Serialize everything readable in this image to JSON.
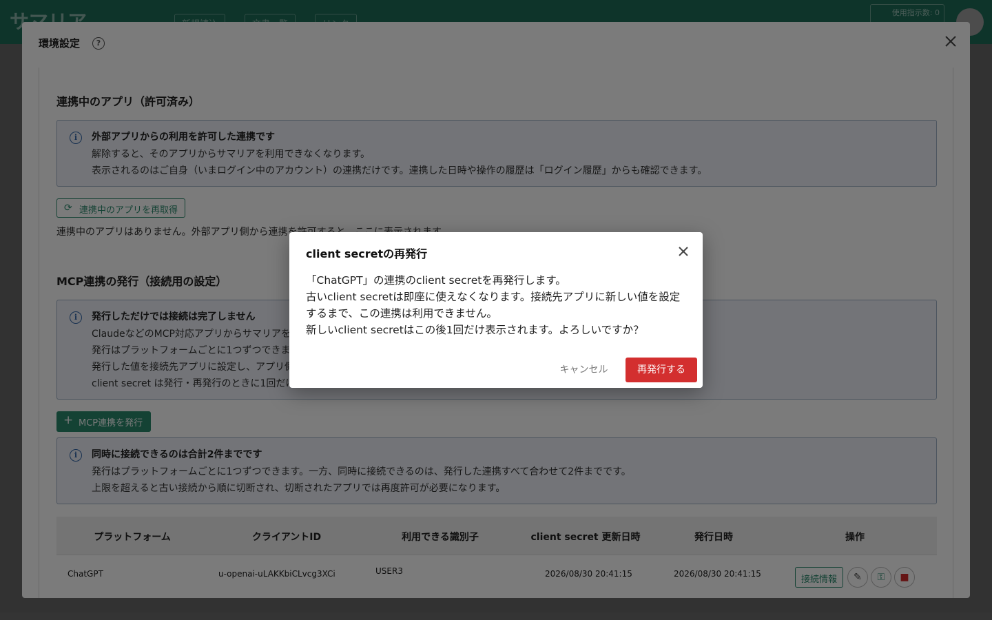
{
  "app": {
    "logo_text": "サマリア",
    "header_buttons": [
      "新規読込",
      "文書一覧",
      "リンク"
    ],
    "counter_label": "使用指示数:",
    "counter_value": "0"
  },
  "settings": {
    "title": "環境設定",
    "connected_apps": {
      "title": "連携中のアプリ（許可済み）",
      "info_head": "外部アプリからの利用を許可した連携です",
      "info_lines": [
        "解除すると、そのアプリからサマリアを利用できなくなります。",
        "表示されるのはご自身（いまログイン中のアカウント）の連携だけです。連携した日時や操作の履歴は「ログイン履歴」からも確認できます。"
      ],
      "refresh_label": "連携中のアプリを再取得",
      "empty_text": "連携中のアプリはありません。外部アプリ側から連携を許可すると、ここに表示されます。"
    },
    "mcp": {
      "title": "MCP連携の発行（接続用の設定）",
      "info_head": "発行しただけでは接続は完了しません",
      "info_lines": [
        "ClaudeなどのMCP対応アプリからサマリアを",
        "発行はプラットフォームごとに1つずつできま",
        "発行した値を接続先アプリに設定し、アプリ側",
        "client secret は発行・再発行のときに1回だけ"
      ],
      "issue_label": "MCP連携を発行",
      "limit_head": "同時に接続できるのは合計2件までです",
      "limit_lines": [
        "発行はプラットフォームごとに1つずつできます。一方、同時に接続できるのは、発行した連携すべて合わせて2件までです。",
        "上限を超えると古い接続から順に切断され、切断されたアプリでは再度許可が必要になります。"
      ]
    },
    "table": {
      "headers": [
        "プラットフォーム",
        "クライアントID",
        "利用できる識別子",
        "client secret 更新日時",
        "発行日時",
        "操作"
      ],
      "rows": [
        {
          "platform": "ChatGPT",
          "client_id": "u-openai-uLAKKbiCLvcg3XCi",
          "identifier": "USER3",
          "secret_updated": "2026/08/30 20:41:15",
          "issued": "2026/08/30 20:41:15",
          "connection_info_label": "接続情報"
        }
      ]
    }
  },
  "confirm": {
    "title": "client secretの再発行",
    "lines": [
      "「ChatGPT」の連携のclient secretを再発行します。",
      "古いclient secretは即座に使えなくなります。接続先アプリに新しい値を設定",
      "するまで、この連携は利用できません。",
      "新しいclient secretはこの後1回だけ表示されます。よろしいですか？"
    ],
    "cancel_label": "キャンセル",
    "confirm_label": "再発行する"
  },
  "colors": {
    "brand": "#1f6d58",
    "accent": "#2a8a6e",
    "danger": "#d32f2f",
    "info_border": "#9fb1c7"
  }
}
